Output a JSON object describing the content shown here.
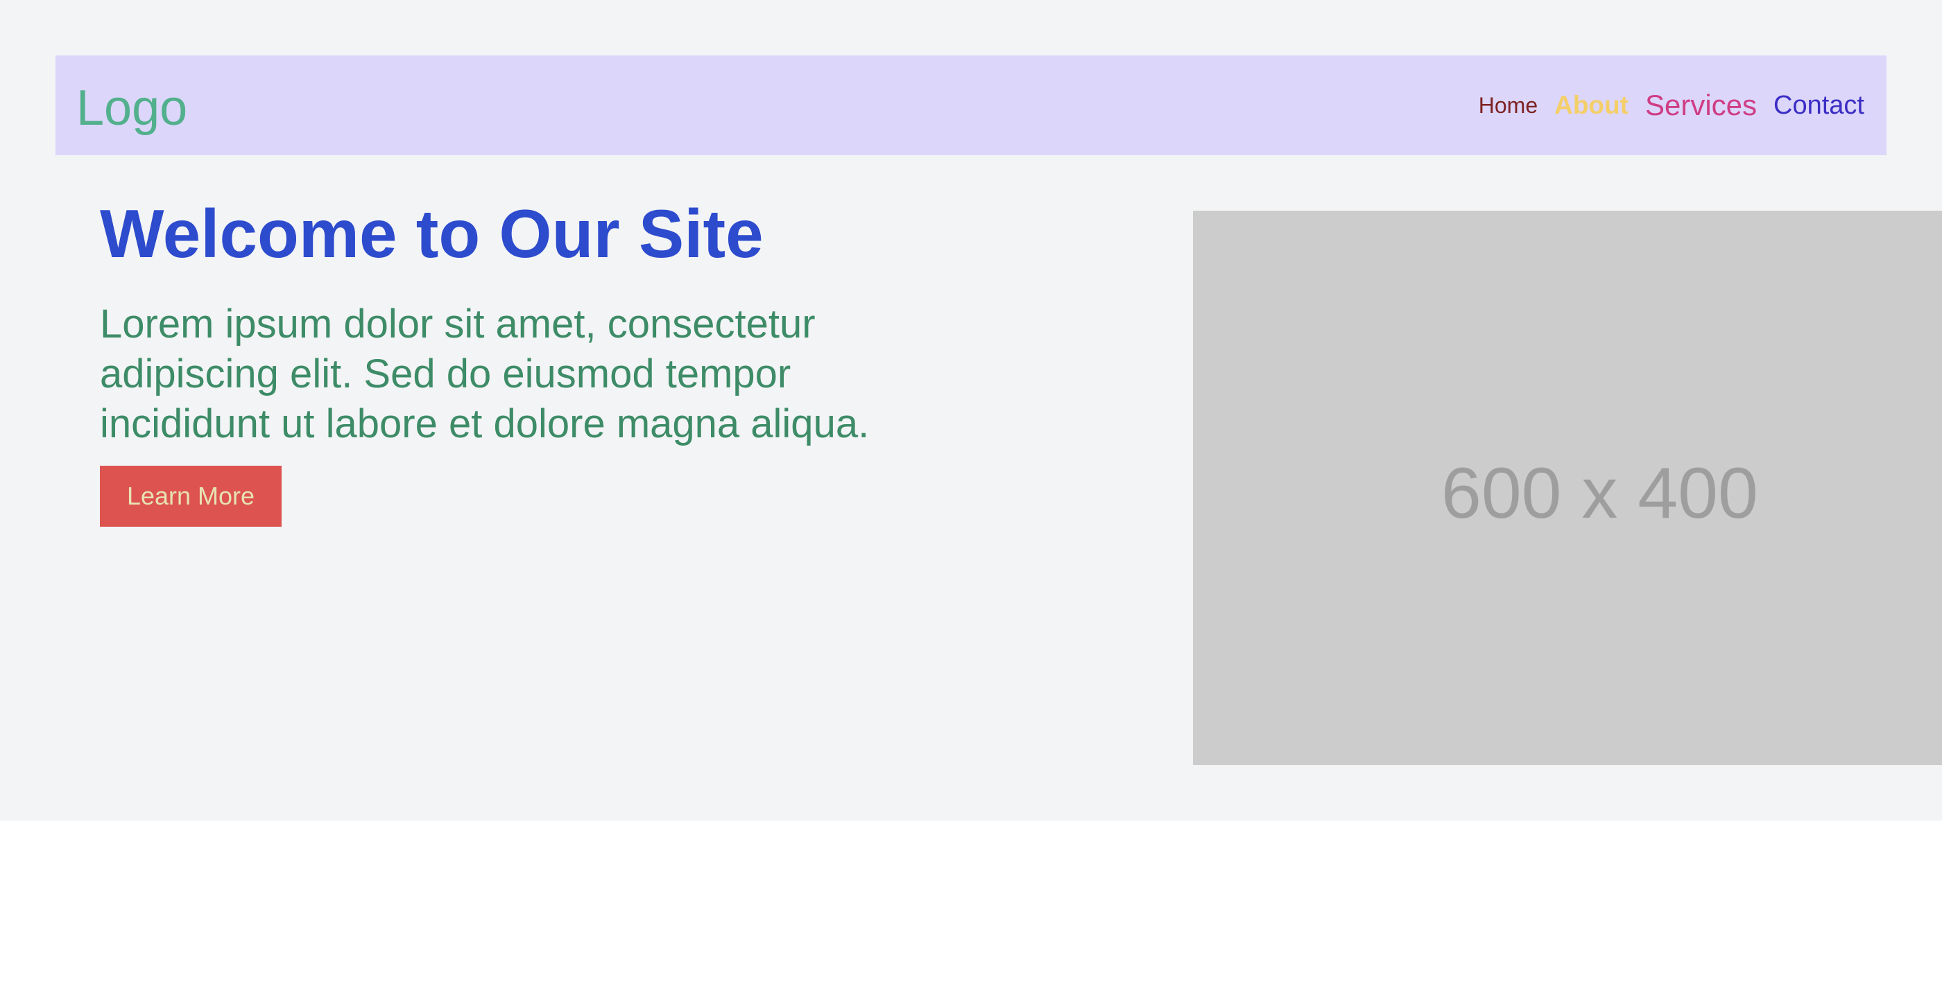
{
  "navbar": {
    "logo": "Logo",
    "links": [
      {
        "label": "Home",
        "color": "#7d2222"
      },
      {
        "label": "About",
        "color": "#f4cf68"
      },
      {
        "label": "Services",
        "color": "#cf3d84"
      },
      {
        "label": "Contact",
        "color": "#3b2dc4"
      }
    ],
    "background": "#dcd6fb"
  },
  "hero": {
    "title": "Welcome to Our Site",
    "text": "Lorem ipsum dolor sit amet, consectetur adipiscing elit. Sed do eiusmod tempor incididunt ut labore et dolore magna aliqua.",
    "button_label": "Learn More",
    "image_placeholder": "600 x 400"
  },
  "colors": {
    "page_background": "#f3f4f6",
    "title": "#2d4bcd",
    "text": "#3d8c67",
    "button": "#dd5350",
    "button_text": "#e7e2b2",
    "logo": "#52b08c"
  }
}
